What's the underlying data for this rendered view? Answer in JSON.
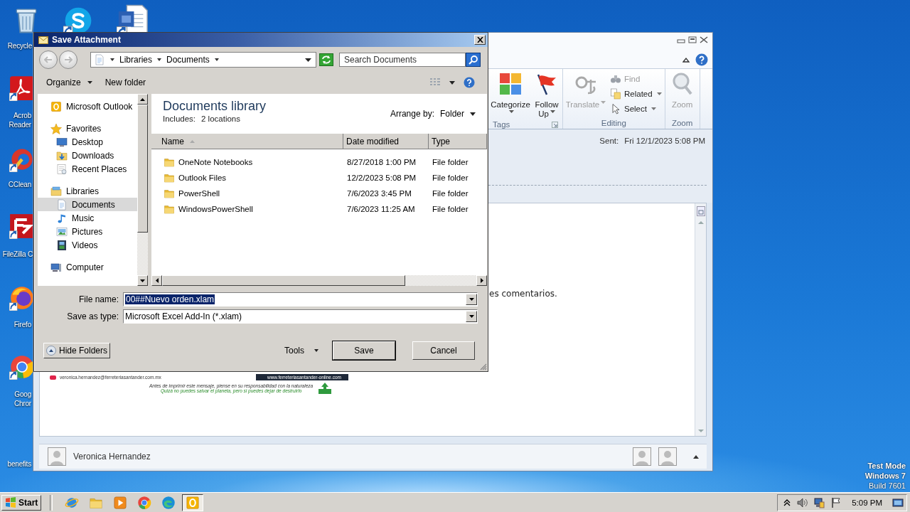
{
  "desktop": {
    "icons": [
      {
        "label": "Recycle",
        "shortcut": false
      },
      {
        "shortcut": true
      },
      {
        "shortcut": true
      },
      {
        "label": "Acrob Reader",
        "shortcut": true
      },
      {
        "label": "CClean",
        "shortcut": true
      },
      {
        "label": "FileZilla C",
        "shortcut": true
      },
      {
        "label": "Firefo",
        "shortcut": true
      },
      {
        "label": "Goog Chror",
        "shortcut": true
      },
      {
        "label": "benefits"
      }
    ],
    "os_notice": [
      "Test Mode",
      "Windows 7",
      "Build 7601"
    ]
  },
  "email_window": {
    "ribbon": {
      "groups": [
        {
          "label": "Tags",
          "launcher": true,
          "commands": [
            {
              "label": "Categorize",
              "kind": "large",
              "dropdown": true,
              "disabled": false
            },
            {
              "label": "Follow Up",
              "kind": "large",
              "dropdown": true,
              "disabled": false
            }
          ]
        },
        {
          "label": "Editing",
          "launcher": false,
          "commands": [
            {
              "label": "Translate",
              "kind": "large",
              "dropdown": true,
              "disabled": true
            },
            {
              "label": "Find",
              "kind": "small",
              "dropdown": false,
              "disabled": true
            },
            {
              "label": "Related",
              "kind": "small",
              "dropdown": true,
              "disabled": false
            },
            {
              "label": "Select",
              "kind": "small",
              "dropdown": true,
              "disabled": false
            }
          ]
        },
        {
          "label": "Zoom",
          "launcher": false,
          "commands": [
            {
              "label": "Zoom",
              "kind": "large",
              "dropdown": false,
              "disabled": true
            }
          ]
        }
      ]
    },
    "header": {
      "sent_label": "Sent:",
      "sent_value": "Fri 12/1/2023 5:08 PM"
    },
    "body": {
      "text_fragment": "es comentarios.",
      "signature": {
        "email": "veronica.hernandez@ferreteriasantander.com.mx",
        "website": "www.ferreteriasantander-online.com",
        "note_lines": [
          "Antes de imprimir este mensaje, piense en su responsabilidad con la naturaleza",
          "Quizá no puedes salvar el planeta, pero si puedes dejar de destruirlo"
        ]
      }
    },
    "people_pane": {
      "name": "Veronica Hernandez"
    }
  },
  "dialog": {
    "title": "Save Attachment",
    "breadcrumb": [
      "Libraries",
      "Documents"
    ],
    "search": {
      "placeholder": "Search Documents"
    },
    "toolbar": {
      "organize": "Organize",
      "new_folder": "New folder"
    },
    "nav": [
      {
        "label": "Microsoft Outlook",
        "selected": false
      },
      {
        "label": "Favorites",
        "selected": false,
        "children": [
          {
            "label": "Desktop",
            "selected": false
          },
          {
            "label": "Downloads",
            "selected": false
          },
          {
            "label": "Recent Places",
            "selected": false
          }
        ]
      },
      {
        "label": "Libraries",
        "selected": false,
        "children": [
          {
            "label": "Documents",
            "selected": true
          },
          {
            "label": "Music",
            "selected": false
          },
          {
            "label": "Pictures",
            "selected": false
          },
          {
            "label": "Videos",
            "selected": false
          }
        ]
      },
      {
        "label": "Computer",
        "selected": false
      }
    ],
    "library": {
      "title": "Documents library",
      "includes_label": "Includes:",
      "includes_value": "2 locations",
      "arrange_label": "Arrange by:",
      "arrange_value": "Folder"
    },
    "columns": [
      {
        "label": "Name",
        "sorted": true
      },
      {
        "label": "Date modified",
        "sorted": false
      },
      {
        "label": "Type",
        "sorted": false
      }
    ],
    "rows": [
      {
        "name": "OneNote Notebooks",
        "date": "8/27/2018 1:00 PM",
        "type": "File folder"
      },
      {
        "name": "Outlook Files",
        "date": "12/2/2023 5:08 PM",
        "type": "File folder"
      },
      {
        "name": "PowerShell",
        "date": "7/6/2023 3:45 PM",
        "type": "File folder"
      },
      {
        "name": "WindowsPowerShell",
        "date": "7/6/2023 11:25 AM",
        "type": "File folder"
      }
    ],
    "file_name": {
      "label": "File name:",
      "value": "00##Nuevo orden.xlam",
      "text_selected": true
    },
    "save_type": {
      "label": "Save as type:",
      "value": "Microsoft Excel Add-In (*.xlam)"
    },
    "buttons": {
      "hide_folders": "Hide Folders",
      "tools": "Tools",
      "save": "Save",
      "cancel": "Cancel"
    }
  },
  "taskbar": {
    "start": "Start",
    "apps": [
      {
        "active": false
      },
      {
        "active": false
      },
      {
        "active": false
      },
      {
        "active": false
      },
      {
        "active": false
      },
      {
        "active": true
      }
    ],
    "clock": "5:09 PM"
  }
}
